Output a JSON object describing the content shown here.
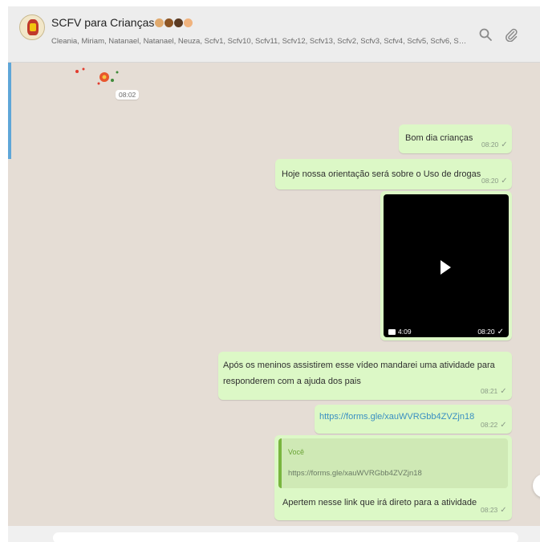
{
  "header": {
    "group_name": "SCFV para Crianças",
    "members": "Cleania, Miriam, Natanael, Natanael, Neuza, Scfv1, Scfv10, Scfv11, Scfv12, Scfv13, Scfv2, Scfv3, Scfv4, Scfv5, Scfv6, Scfv7, Sc...",
    "icons": [
      "search-icon",
      "paperclip-icon"
    ]
  },
  "prev_message_time": "08:02",
  "messages": [
    {
      "text": "Bom dia crianças",
      "time": "08:20",
      "status": "✓"
    },
    {
      "text": "Hoje nossa orientação será sobre o Uso de drogas",
      "time": "08:20",
      "status": "✓"
    },
    {
      "type": "video",
      "duration": "4:09",
      "time": "08:20",
      "status": "✓"
    },
    {
      "lines": [
        "Após os meninos assistirem esse vídeo mandarei uma atividade para",
        "responderem com a ajuda dos pais"
      ],
      "time": "08:21",
      "status": "✓"
    },
    {
      "text": "https://forms.gle/xauWVRGbb4ZVZjn18",
      "time": "08:22",
      "status": "✓"
    },
    {
      "quote_author": "Você",
      "quote_text": "https://forms.gle/xauWVRGbb4ZVZjn18",
      "text": "Apertem nesse link que irá direto para a atividade",
      "time": "08:23",
      "status": "✓"
    }
  ],
  "colors": {
    "chat_background": "#e5ddd5",
    "outgoing_bubble": "#dcf8c6",
    "link": "#3a8fc2",
    "quote_accent": "#79b53f"
  }
}
